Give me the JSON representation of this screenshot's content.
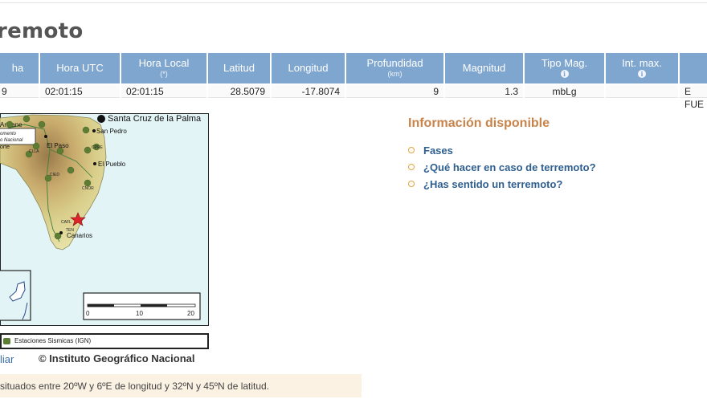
{
  "page": {
    "title": "remoto"
  },
  "table": {
    "headers": [
      {
        "id": "fecha",
        "label": "ha",
        "sub": ""
      },
      {
        "id": "hora_utc",
        "label": "Hora UTC",
        "sub": ""
      },
      {
        "id": "hora_local",
        "label": "Hora Local",
        "sub": "(*)"
      },
      {
        "id": "latitud",
        "label": "Latitud",
        "sub": ""
      },
      {
        "id": "longitud",
        "label": "Longitud",
        "sub": ""
      },
      {
        "id": "profundidad",
        "label": "Profundidad",
        "sub": "(km)"
      },
      {
        "id": "magnitud",
        "label": "Magnitud",
        "sub": ""
      },
      {
        "id": "tipo_mag",
        "label": "Tipo Mag.",
        "sub": "i"
      },
      {
        "id": "int_max",
        "label": "Int. max.",
        "sub": "i"
      },
      {
        "id": "region",
        "label": "",
        "sub": ""
      }
    ],
    "row": {
      "fecha": "9",
      "hora_utc": "02:01:15",
      "hora_local": "02:01:15",
      "latitud": "28.5079",
      "longitud": "-17.8074",
      "profundidad": "9",
      "magnitud": "1.3",
      "tipo_mag": "mbLg",
      "int_max": "",
      "region": "E FUE"
    }
  },
  "map": {
    "places": {
      "santa_cruz": "Santa Cruz de la Palma",
      "san_pedro": "San Pedro",
      "el_paso": "El Paso",
      "el_pueblo": "El Pueblo",
      "canarios": "Canarios",
      "aridane": "Aridane",
      "orte": "orte"
    },
    "box_text": [
      "omento",
      "o Nacional"
    ],
    "stations": [
      "CLLA",
      "CPRE",
      "CIED",
      "CNOR",
      "CAFL",
      "TEN"
    ],
    "scale": {
      "labels": [
        "0",
        "10",
        "20"
      ]
    },
    "legend_label": "Estaciones Sismicas (IGN)"
  },
  "footer": {
    "link": "liar",
    "copyright": "© Instituto Geográfico Nacional",
    "note": "situados entre 20ºW y 6ºE de longitud y 32ºN y 45ºN de latitud."
  },
  "info_panel": {
    "title": "Información disponible",
    "links": [
      "Fases",
      "¿Qué hacer en caso de terremoto?",
      "¿Has sentido un terremoto?"
    ]
  },
  "colors": {
    "header_bg": "#7fa6cf",
    "accent": "#c8834a",
    "link": "#2f5f8f",
    "epicenter": "#e0242b"
  }
}
